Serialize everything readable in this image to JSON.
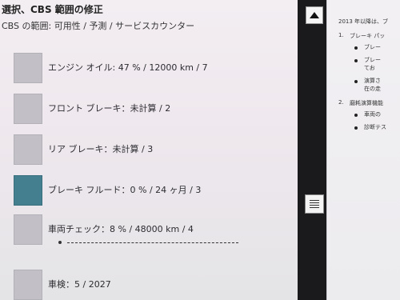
{
  "header": {
    "title": "選択、CBS 範囲の修正",
    "subtitle": "CBS の範囲: 可用性 / 予測 / サービスカウンター"
  },
  "items": [
    {
      "label": "エンジン オイル: 47 % / 12000 km / 7",
      "color": "#c2c0c6"
    },
    {
      "label": "フロント ブレーキ：未計算 / 2",
      "color": "#c2c0c6"
    },
    {
      "label": "リア ブレーキ：未計算 / 3",
      "color": "#c2c0c6"
    },
    {
      "label": "ブレーキ フルード：0 % / 24 ヶ月 / 3",
      "color": "#447f8f"
    },
    {
      "label": "車両チェック：8 % / 48000 km / 4",
      "color": "#c2c0c6"
    },
    {
      "label": "車検：5 / 2027",
      "color": "#c2c0c6"
    }
  ],
  "scrollbar": {
    "up_icon": "triangle-up-icon",
    "thumb_icon": "grip-lines-icon"
  },
  "side": {
    "line1": "2013 年以降は、ブ",
    "n1": "1.",
    "s1": "ブレーキ パッ",
    "b1": "ブレー",
    "b2a": "ブレー",
    "b2b": "てお",
    "b3a": "演算さ",
    "b3b": "在の走",
    "n2": "2.",
    "s2": "磨耗演算機能",
    "b4": "車両の",
    "b5": "診断テス"
  }
}
